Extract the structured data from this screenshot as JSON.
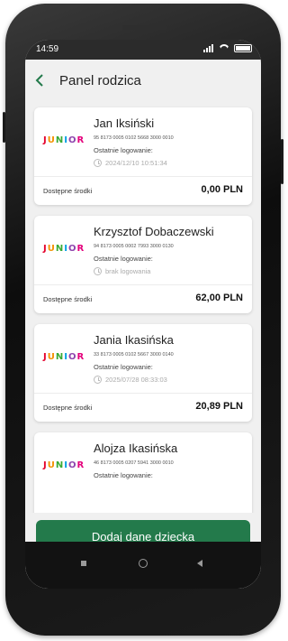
{
  "status_bar": {
    "time": "14:59"
  },
  "header": {
    "title": "Panel rodzica"
  },
  "accounts": [
    {
      "logo": [
        "J",
        "U",
        "N",
        "I",
        "O",
        "R"
      ],
      "name": "Jan Iksiński",
      "account_number": "95 8173 0005 0102 5668 3000 0010",
      "last_login_label": "Ostatnie logowanie:",
      "last_login": "2024/12/10 10:51:34",
      "available_label": "Dostępne środki",
      "available": "0,00 PLN"
    },
    {
      "logo": [
        "J",
        "U",
        "N",
        "I",
        "O",
        "R"
      ],
      "name": "Krzysztof Dobaczewski",
      "account_number": "94 8173 0005 0002 7993 3000 0130",
      "last_login_label": "Ostatnie logowanie:",
      "last_login": "brak logowania",
      "available_label": "Dostępne środki",
      "available": "62,00 PLN"
    },
    {
      "logo": [
        "J",
        "U",
        "N",
        "I",
        "O",
        "R"
      ],
      "name": "Jania Ikasińska",
      "account_number": "33 8173 0005 0102 5667 3000 0140",
      "last_login_label": "Ostatnie logowanie:",
      "last_login": "2025/07/28 08:33:03",
      "available_label": "Dostępne środki",
      "available": "20,89 PLN"
    },
    {
      "logo": [
        "J",
        "U",
        "N",
        "I",
        "O",
        "R"
      ],
      "name": "Alojza Ikasińska",
      "account_number": "46 8173 0005 0207 5941 3000 0010",
      "last_login_label": "Ostatnie logowanie:"
    }
  ],
  "actions": {
    "add_child": "Dodaj dane dziecka"
  },
  "colors": {
    "primary": "#237a4b",
    "background": "#f0f0f0"
  }
}
